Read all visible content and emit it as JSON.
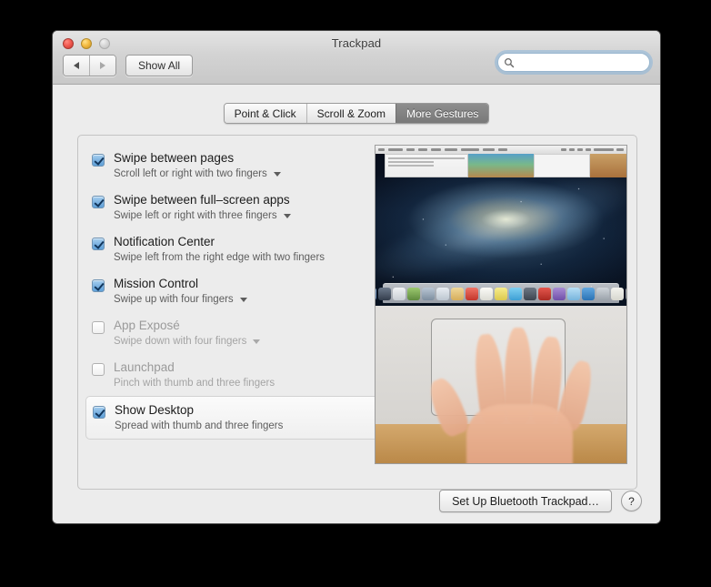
{
  "window": {
    "title": "Trackpad",
    "traffic_lights": [
      "close",
      "minimize",
      "zoom"
    ],
    "back_label": "back-arrow",
    "forward_label": "forward-arrow",
    "show_all_label": "Show All",
    "search": {
      "value": "",
      "placeholder": "",
      "icon": "search-icon"
    }
  },
  "tabs": [
    {
      "label": "Point & Click",
      "active": false
    },
    {
      "label": "Scroll & Zoom",
      "active": false
    },
    {
      "label": "More Gestures",
      "active": true
    }
  ],
  "gestures": [
    {
      "title": "Swipe between pages",
      "subtitle": "Scroll left or right with two fingers",
      "checked": true,
      "enabled": true,
      "has_menu": true,
      "selected": false
    },
    {
      "title": "Swipe between full–screen apps",
      "subtitle": "Swipe left or right with three fingers",
      "checked": true,
      "enabled": true,
      "has_menu": true,
      "selected": false
    },
    {
      "title": "Notification Center",
      "subtitle": "Swipe left from the right edge with two fingers",
      "checked": true,
      "enabled": true,
      "has_menu": false,
      "selected": false
    },
    {
      "title": "Mission Control",
      "subtitle": "Swipe up with four fingers",
      "checked": true,
      "enabled": true,
      "has_menu": true,
      "selected": false
    },
    {
      "title": "App Exposé",
      "subtitle": "Swipe down with four fingers",
      "checked": false,
      "enabled": false,
      "has_menu": true,
      "selected": false
    },
    {
      "title": "Launchpad",
      "subtitle": "Pinch with thumb and three fingers",
      "checked": false,
      "enabled": false,
      "has_menu": false,
      "selected": false
    },
    {
      "title": "Show Desktop",
      "subtitle": "Spread with thumb and three fingers",
      "checked": true,
      "enabled": true,
      "has_menu": false,
      "selected": true
    }
  ],
  "preview": {
    "description": "Animated demo: hand spreading thumb and three fingers on a trackpad, revealing the desktop",
    "desktop_wallpaper": "galaxy",
    "dock_icons": [
      "#6f8fb5",
      "#3f4e63",
      "#d9dde2",
      "#7fa85a",
      "#9aa7b4",
      "#cfd6dd",
      "#e0c07a",
      "#e05a4a",
      "#f2f2ef",
      "#f0e06a",
      "#5db6e8",
      "#4a5560",
      "#d03a33",
      "#8e6fc0",
      "#9fd0ec",
      "#2e86c9",
      "#b9bfc6",
      "#e9e9e6",
      "#8c8f93"
    ]
  },
  "footer": {
    "bluetooth_button": "Set Up Bluetooth Trackpad…",
    "help_button": "?"
  },
  "colors": {
    "window_bg": "#ececec",
    "titlebar_top": "#e4e4e4",
    "titlebar_bottom": "#c8c8c8",
    "active_tab_bg": "#797979",
    "checkbox_on": "#7fb4e2",
    "desktop_black": "#000000"
  }
}
